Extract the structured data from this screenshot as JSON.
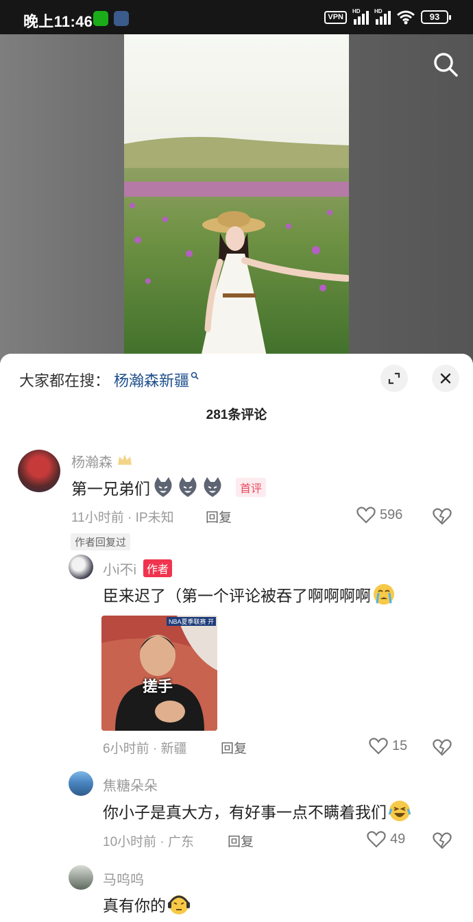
{
  "status_bar": {
    "time": "晚上11:46",
    "vpn": "VPN",
    "hd1": "HD",
    "hd2": "HD",
    "battery": "93"
  },
  "video": {
    "search_icon": "search-icon"
  },
  "comments_panel": {
    "hot_search_label": "大家都在搜：",
    "hot_search_keyword": "杨瀚森新疆",
    "comment_count": "281条评论",
    "expand_icon": "expand-icon",
    "close_icon": "close-icon"
  },
  "comments": [
    {
      "username": "杨瀚森",
      "text": "第一兄弟们",
      "badge": "首评",
      "time": "11小时前",
      "location": "IP未知",
      "reply_label": "回复",
      "likes": "596",
      "author_replied": "作者回复过"
    }
  ],
  "replies": [
    {
      "username": "小i不i",
      "badge": "作者",
      "text": "臣来迟了（第一个评论被吞了啊啊啊啊",
      "image_caption": "搓手",
      "image_tag": "NBA夏季联赛 开",
      "time": "6小时前",
      "location": "新疆",
      "reply_label": "回复",
      "likes": "15"
    },
    {
      "username": "焦糖朵朵",
      "text": "你小子是真大方，有好事一点不瞒着我们",
      "time": "10小时前",
      "location": "广东",
      "reply_label": "回复",
      "likes": "49"
    },
    {
      "username": "马呜呜",
      "text": "真有你的"
    }
  ],
  "colors": {
    "accent_red": "#f0344e",
    "keyword_blue": "#1e4f8c",
    "meta_gray": "#9a9a9a"
  }
}
